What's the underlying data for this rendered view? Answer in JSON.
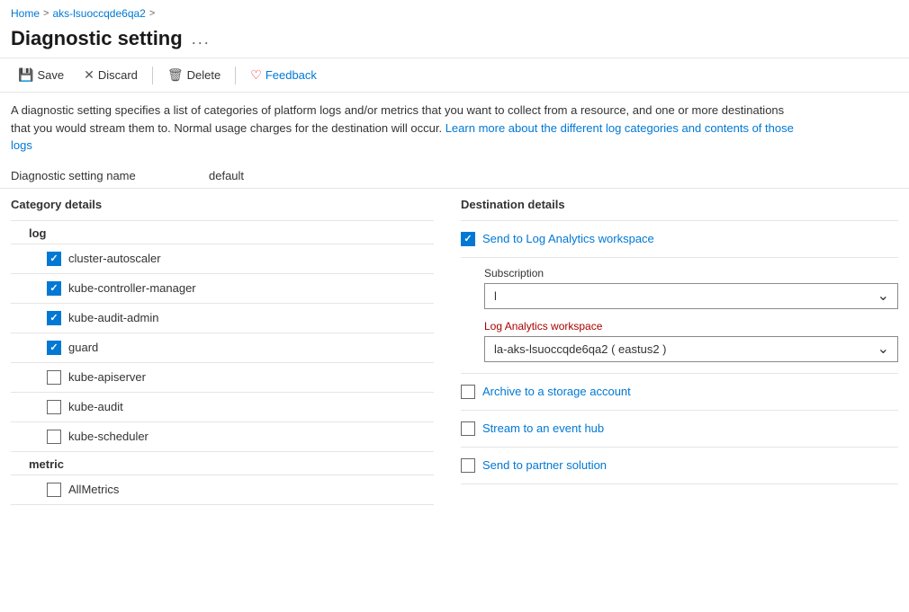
{
  "breadcrumb": {
    "home": "Home",
    "resource": "aks-lsuoccqde6qa2",
    "sep1": ">",
    "sep2": ">"
  },
  "page": {
    "title": "Diagnostic setting",
    "more_icon": "...",
    "description": "A diagnostic setting specifies a list of categories of platform logs and/or metrics that you want to collect from a resource, and one or more destinations that you would stream them to. Normal usage charges for the destination will occur.",
    "learn_more_text": "Learn more about the different log categories and contents of those logs",
    "learn_more_url": "#"
  },
  "toolbar": {
    "save_label": "Save",
    "discard_label": "Discard",
    "delete_label": "Delete",
    "feedback_label": "Feedback"
  },
  "setting": {
    "name_label": "Diagnostic setting name",
    "name_value": "default"
  },
  "category_panel": {
    "title": "Category details",
    "log_section": "log",
    "metric_section": "metric",
    "log_items": [
      {
        "id": "cluster-autoscaler",
        "label": "cluster-autoscaler",
        "checked": true
      },
      {
        "id": "kube-controller-manager",
        "label": "kube-controller-manager",
        "checked": true
      },
      {
        "id": "kube-audit-admin",
        "label": "kube-audit-admin",
        "checked": true
      },
      {
        "id": "guard",
        "label": "guard",
        "checked": true
      },
      {
        "id": "kube-apiserver",
        "label": "kube-apiserver",
        "checked": false
      },
      {
        "id": "kube-audit",
        "label": "kube-audit",
        "checked": false
      },
      {
        "id": "kube-scheduler",
        "label": "kube-scheduler",
        "checked": false
      }
    ],
    "metric_items": [
      {
        "id": "AllMetrics",
        "label": "AllMetrics",
        "checked": false
      }
    ]
  },
  "destination_panel": {
    "title": "Destination details",
    "send_to_log_analytics": {
      "label": "Send to Log Analytics workspace",
      "checked": true
    },
    "subscription_label": "Subscription",
    "subscription_value": "l",
    "log_analytics_label": "Log Analytics workspace",
    "log_analytics_value": "la-aks-lsuoccqde6qa2 ( eastus2 )",
    "archive_label": "Archive to a storage account",
    "archive_checked": false,
    "stream_label": "Stream to an event hub",
    "stream_checked": false,
    "partner_label": "Send to partner solution",
    "partner_checked": false
  }
}
